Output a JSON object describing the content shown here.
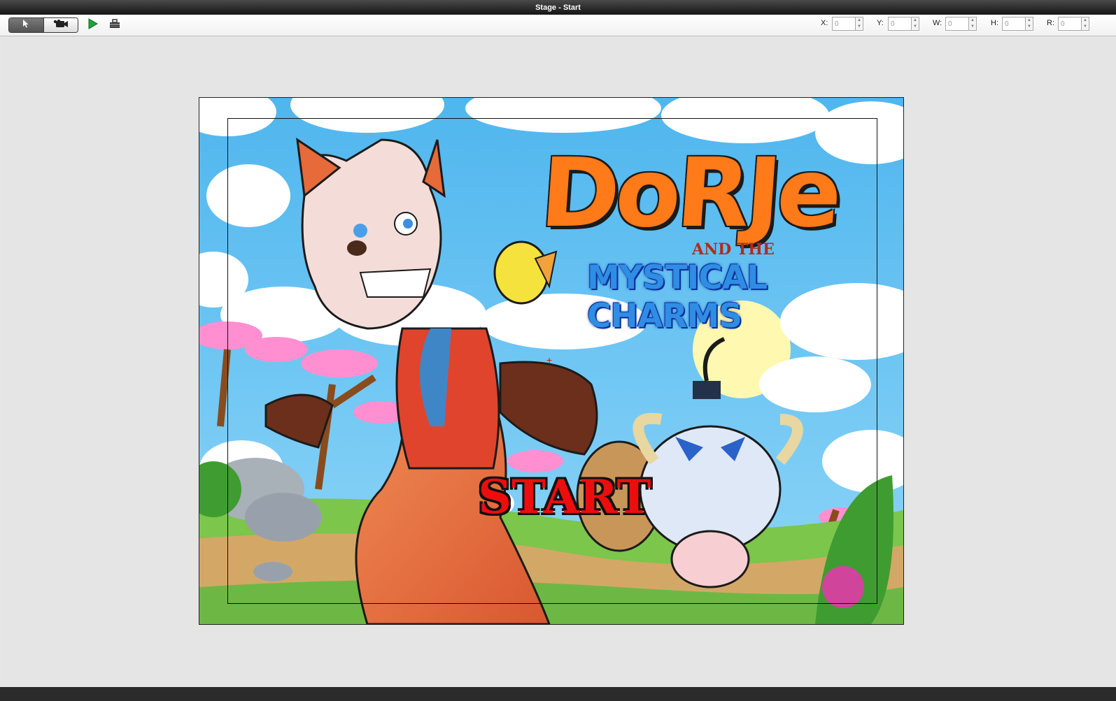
{
  "window": {
    "title": "Stage - Start"
  },
  "toolbar": {
    "select_tool": "cursor-arrow-icon",
    "camera_tool": "video-camera-icon",
    "play": "play-icon",
    "preview": "toolbox-icon",
    "fields": [
      {
        "label": "X:",
        "value": "0"
      },
      {
        "label": "Y:",
        "value": "0"
      },
      {
        "label": "W:",
        "value": "0"
      },
      {
        "label": "H:",
        "value": "0"
      },
      {
        "label": "R:",
        "value": "0"
      }
    ]
  },
  "stage": {
    "title_logo": "DoRJe",
    "title_and": "AND THE",
    "title_sub": "MYSTICAL CHARMS",
    "start_label": "START"
  },
  "colors": {
    "play": "#22a33a",
    "start": "#ee0d0d",
    "logo": "#ff7a19",
    "sub": "#2f8de4"
  }
}
